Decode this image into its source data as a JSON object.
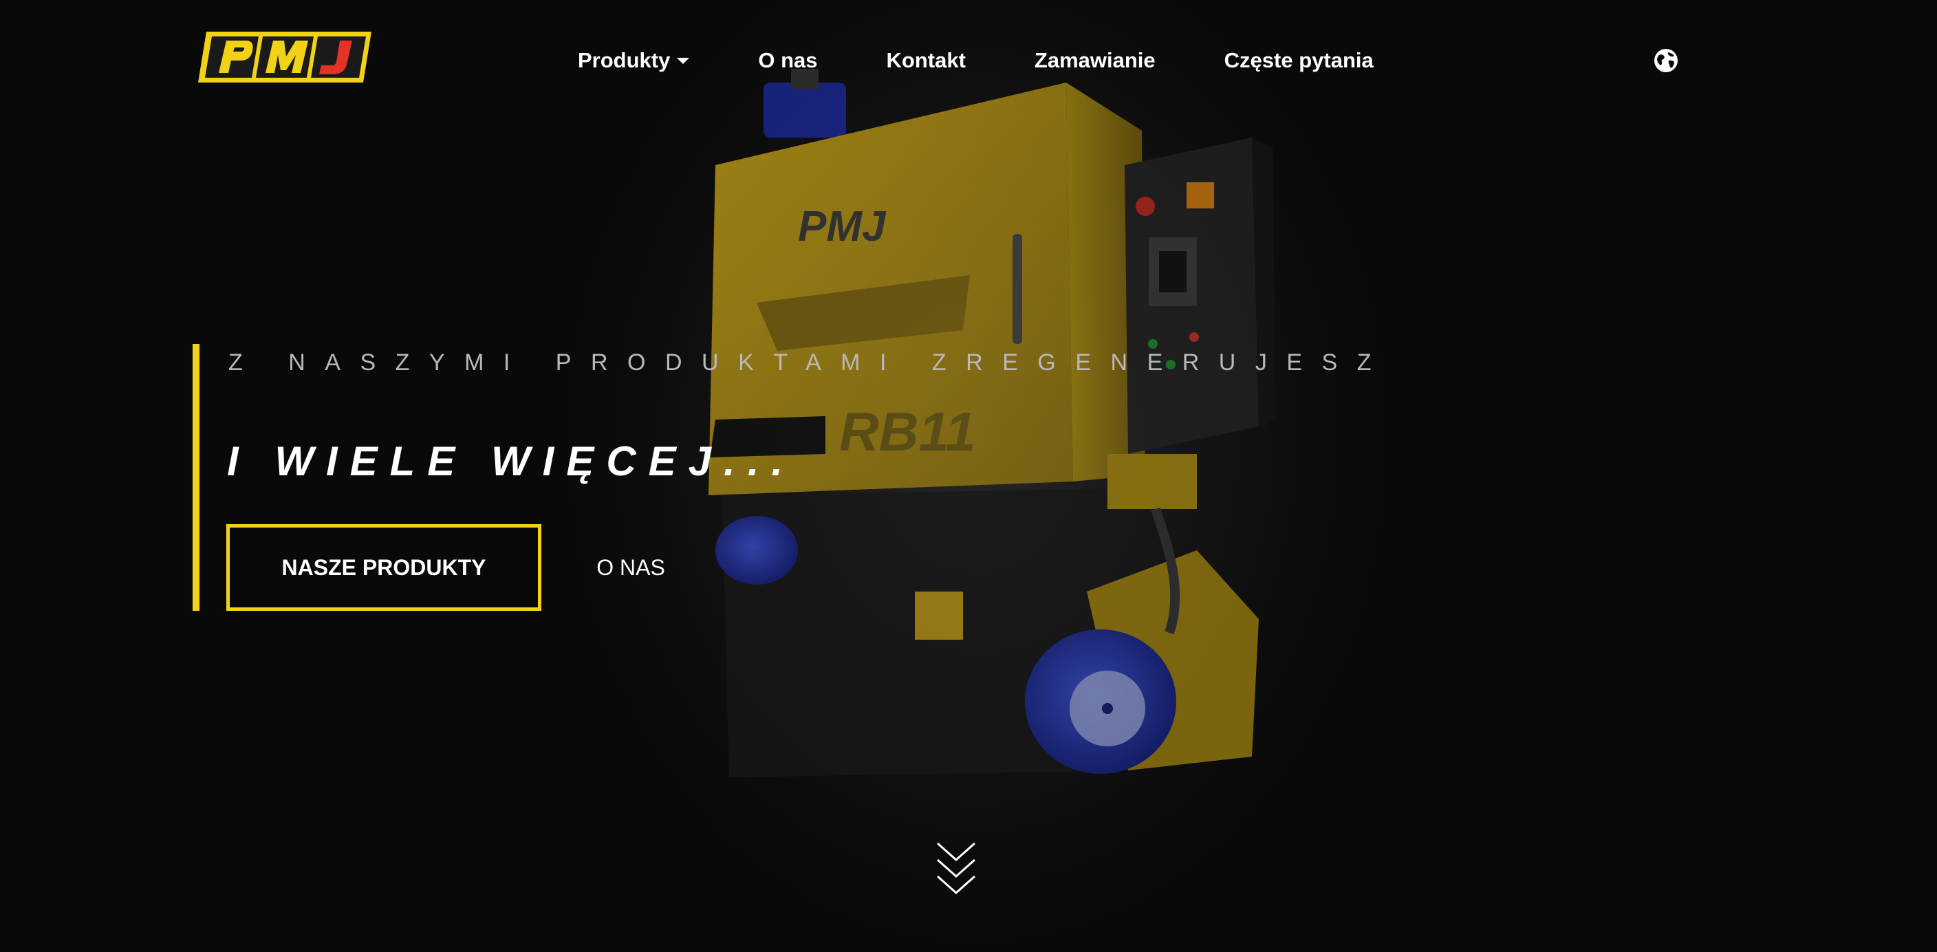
{
  "brand": {
    "logo_text": "PMJ",
    "accent_color": "#f2d217",
    "logo_red": "#e53222"
  },
  "nav": {
    "items": [
      {
        "label": "Produkty",
        "has_dropdown": true
      },
      {
        "label": "O nas"
      },
      {
        "label": "Kontakt"
      },
      {
        "label": "Zamawianie"
      },
      {
        "label": "Częste pytania"
      }
    ],
    "language_icon": "globe-icon"
  },
  "hero": {
    "kicker": "Z NASZYMI PRODUKTAMI ZREGENERUJESZ",
    "headline": "I WIELE WIĘCEJ...",
    "primary_button": "NASZE PRODUKTY",
    "secondary_button": "O NAS",
    "machine_logo": "PMJ",
    "machine_model": "RB11",
    "scroll_icon": "double-chevron-down-icon"
  }
}
